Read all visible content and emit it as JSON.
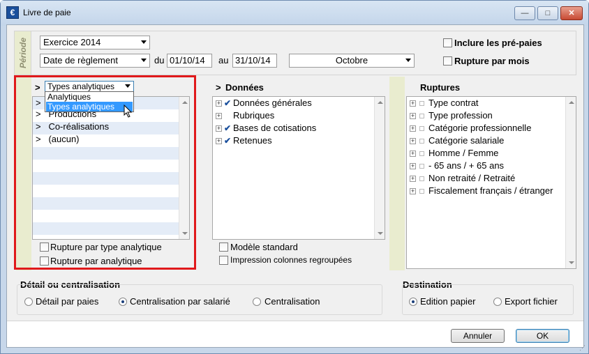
{
  "window": {
    "title": "Livre de paie",
    "app_icon": "€"
  },
  "periode": {
    "label": "Période",
    "exercice": "Exercice 2014",
    "date_type": "Date de règlement",
    "du_label": "du",
    "date_from": "01/10/14",
    "au_label": "au",
    "date_to": "31/10/14",
    "month": "Octobre",
    "include_prepaies": "Inclure les pré-paies",
    "rupture_mois": "Rupture par mois"
  },
  "analytique": {
    "selector_value": "Types analytiques",
    "dropdown_options": [
      "Analytiques",
      "Types analytiques"
    ],
    "items": [
      "Productions",
      "Co-réalisations",
      "(aucun)"
    ],
    "rupture_type": "Rupture par type analytique",
    "rupture_analytique": "Rupture par analytique"
  },
  "donnees": {
    "header": "Données",
    "items": [
      "Données générales",
      "Rubriques",
      "Bases de cotisations",
      "Retenues"
    ],
    "checked": [
      true,
      false,
      true,
      true
    ],
    "modele_standard": "Modèle standard",
    "impression_colonnes": "Impression colonnes regroupées"
  },
  "ruptures": {
    "header": "Ruptures",
    "items": [
      "Type contrat",
      "Type profession",
      "Catégorie professionnelle",
      "Catégorie salariale",
      "Homme / Femme",
      "- 65 ans / + 65 ans",
      "Non retraité / Retraité",
      "Fiscalement français / étranger"
    ]
  },
  "detail": {
    "title": "Détail ou centralisation",
    "options": [
      "Détail par paies",
      "Centralisation par salarié",
      "Centralisation"
    ],
    "selected": "Centralisation par salarié"
  },
  "destination": {
    "title": "Destination",
    "options": [
      "Edition papier",
      "Export fichier"
    ],
    "selected": "Edition papier"
  },
  "footer": {
    "annuler": "Annuler",
    "ok": "OK"
  },
  "colors": {
    "highlight": "#e0191b",
    "selection": "#3399ff",
    "sidebar": "#e9eccf"
  }
}
